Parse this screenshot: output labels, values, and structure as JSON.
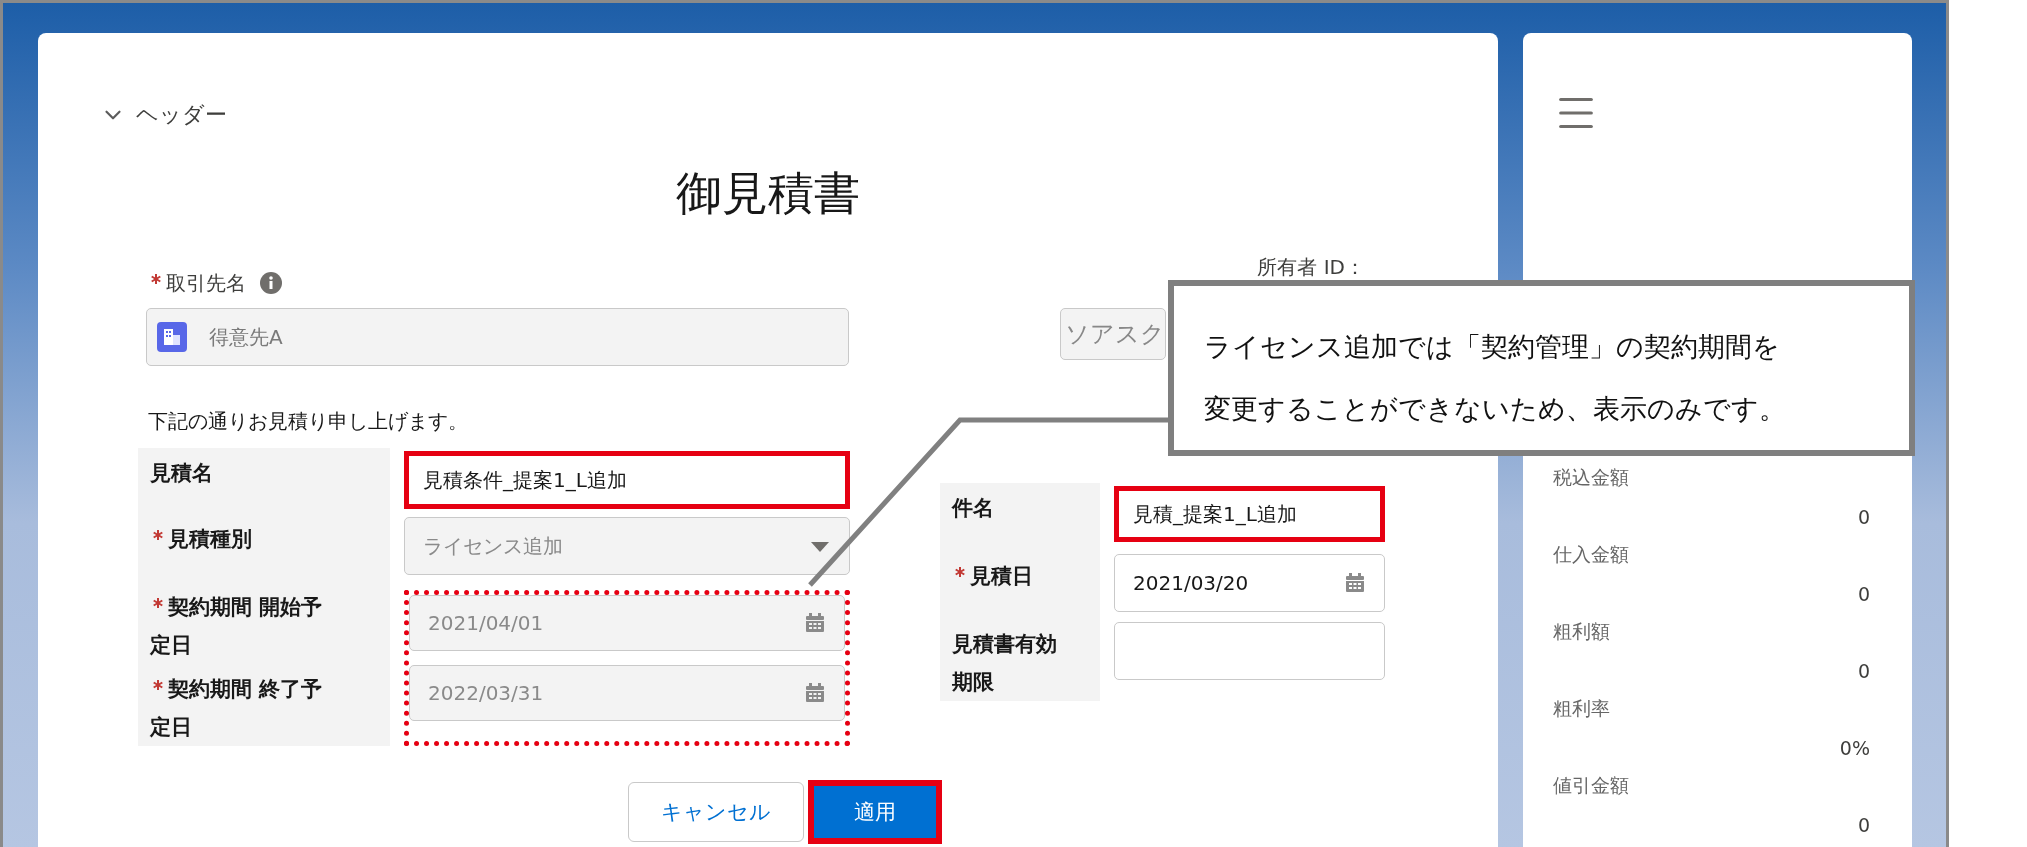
{
  "header_section": {
    "label": "ヘッダー",
    "expanded": true
  },
  "title": "御見積書",
  "account": {
    "label": "取引先名",
    "required": true,
    "value": "得意先A",
    "disabled": true
  },
  "owner": {
    "label": "所有者 ID：",
    "value": "ソアスク"
  },
  "intro": "下記の通りお見積り申し上げます。",
  "left_fields": [
    {
      "label": "見積名",
      "required": false,
      "kind": "text",
      "value": "見積条件_提案1_L追加",
      "disabled": false,
      "highlighted": true
    },
    {
      "label": "見積種別",
      "required": true,
      "kind": "select",
      "value": "ライセンス追加",
      "disabled": true,
      "highlighted": false
    }
  ],
  "locked_group": {
    "highlighted": true,
    "fields": [
      {
        "label": "契約期間 開始予定日",
        "required": true,
        "kind": "date",
        "value": "2021/04/01",
        "disabled": true,
        "highlighted": false
      },
      {
        "label": "契約期間 終了予定日",
        "required": true,
        "kind": "date",
        "value": "2022/03/31",
        "disabled": true,
        "highlighted": false
      }
    ]
  },
  "right_fields": [
    {
      "label": "件名",
      "required": false,
      "kind": "text",
      "value": "見積_提案1_L追加",
      "disabled": false,
      "highlighted": true
    },
    {
      "label": "見積日",
      "required": true,
      "kind": "date",
      "value": "2021/03/20",
      "disabled": false,
      "highlighted": false
    },
    {
      "label": "見積書有効期限",
      "required": false,
      "kind": "text",
      "disabled": false,
      "highlighted": false
    }
  ],
  "buttons": [
    {
      "label": "キャンセル",
      "kind": "neutral",
      "highlighted": false
    },
    {
      "label": "適用",
      "kind": "brand",
      "highlighted": true
    }
  ],
  "callout": {
    "lines": [
      "ライセンス追加では「契約管理」の契約期間を",
      "変更することができないため、表示のみです。"
    ]
  },
  "summary": [
    {
      "label": "税込金額",
      "value": "0"
    },
    {
      "label": "仕入金額",
      "value": "0"
    },
    {
      "label": "粗利額",
      "value": "0"
    },
    {
      "label": "粗利率",
      "value": "0%"
    },
    {
      "label": "値引金額",
      "value": "0"
    }
  ]
}
